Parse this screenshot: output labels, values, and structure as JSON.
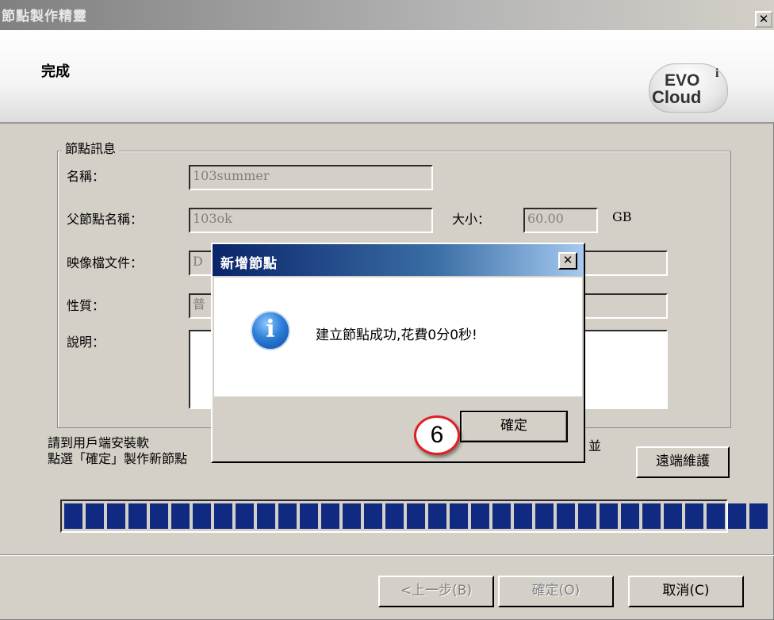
{
  "window": {
    "title": "節點製作精靈",
    "close_label": "✕"
  },
  "header": {
    "title": "完成",
    "logo": {
      "top": "EVO",
      "bottom": "Cloud",
      "badge": "i"
    }
  },
  "group": {
    "legend": "節點訊息",
    "name_label": "名稱：",
    "name_value": "103summer",
    "parent_label": "父節點名稱：",
    "parent_value": "103ok",
    "size_label": "大小：",
    "size_value": "60.00",
    "size_unit": "GB",
    "image_label": "映像檔文件：",
    "image_value": "D",
    "type_label": "性質：",
    "type_value": "普",
    "desc_label": "說明："
  },
  "instructions": {
    "line1": "請到用戶端安裝軟",
    "line2": "點選「確定」製作新節點",
    "right_fragment": "並"
  },
  "remote_button": "遠端維護",
  "progress": {
    "blocks": 33
  },
  "footer": {
    "back": "<上一步(B)",
    "confirm": "確定(O)",
    "cancel": "取消(C)"
  },
  "dialog": {
    "title": "新增節點",
    "close_label": "✕",
    "icon": "info-icon",
    "message": "建立節點成功,花費0分0秒!",
    "ok_label": "確定"
  },
  "step_marker": "6",
  "colors": {
    "progress": "#102a82",
    "dialog_titlebar": "#0a246a",
    "marker_ring": "#e02020"
  }
}
